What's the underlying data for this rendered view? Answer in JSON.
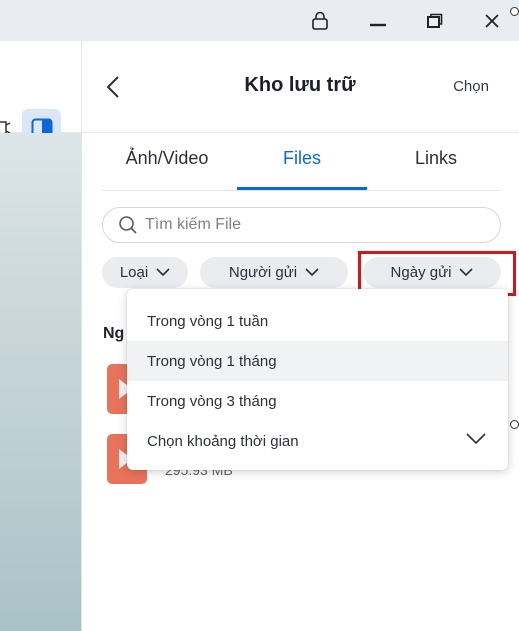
{
  "window": {
    "icons": [
      "lock-icon",
      "minimize-icon",
      "restore-icon",
      "close-icon"
    ]
  },
  "header": {
    "title": "Kho lưu trữ",
    "select_label": "Chọn"
  },
  "tabs": [
    {
      "label": "Ảnh/Video",
      "active": false
    },
    {
      "label": "Files",
      "active": true
    },
    {
      "label": "Links",
      "active": false
    }
  ],
  "search": {
    "placeholder": "Tìm kiếm File",
    "value": ""
  },
  "filters": {
    "type_label": "Loại",
    "sender_label": "Người gửi",
    "date_label": "Ngày gửi"
  },
  "list": {
    "group_label": "Ng",
    "files": [
      {
        "size": ""
      },
      {
        "size": "295.93 MB"
      }
    ]
  },
  "date_dropdown": {
    "options": [
      {
        "label": "Trong vòng 1 tuần"
      },
      {
        "label": "Trong vòng 1 tháng",
        "hovered": true
      },
      {
        "label": "Trong vòng 3 tháng"
      },
      {
        "label": "Chọn khoảng thời gian"
      }
    ]
  },
  "colors": {
    "accent": "#0a68d8",
    "highlight": "#d4151c",
    "file_icon": "#e9735a",
    "titlebar": "#e9ecf1"
  }
}
